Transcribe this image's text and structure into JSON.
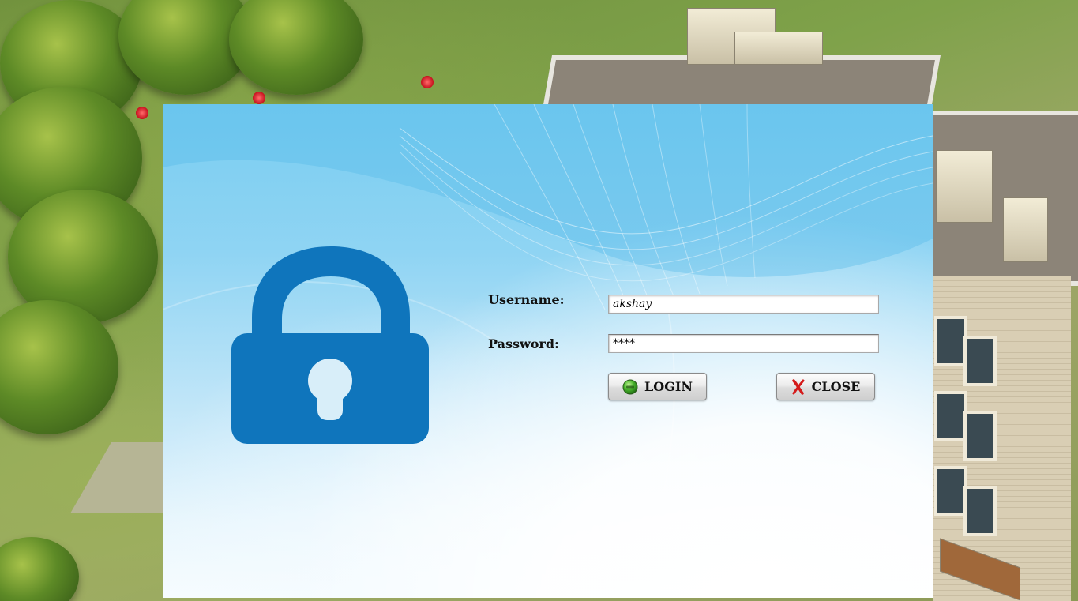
{
  "form": {
    "username_label": "Username:",
    "username_value": "akshay",
    "password_label": "Password:",
    "password_value": "****"
  },
  "buttons": {
    "login_label": "LOGIN",
    "close_label": "CLOSE"
  },
  "icons": {
    "lock": "padlock-icon",
    "login": "green-dot-icon",
    "close": "red-x-icon"
  },
  "colors": {
    "lock_blue": "#0f75bc",
    "panel_top": "#79cdf1",
    "panel_bottom": "#f7fcff",
    "login_icon": "#3fae2a",
    "close_icon": "#d41a1a"
  }
}
